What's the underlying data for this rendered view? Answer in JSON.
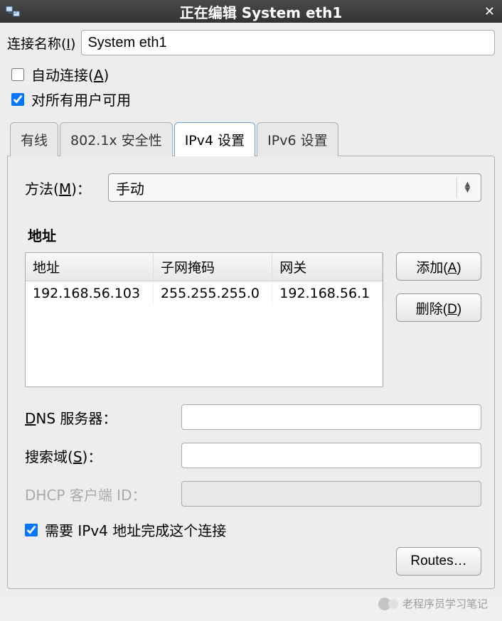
{
  "titlebar": {
    "title": "正在编辑  System eth1"
  },
  "connection": {
    "name_label_prefix": "连接名称(",
    "name_label_key": "I",
    "name_label_suffix": ")",
    "name_value": "System eth1"
  },
  "checkboxes": {
    "autoconnect_prefix": "自动连接(",
    "autoconnect_key": "A",
    "autoconnect_suffix": ")",
    "all_users": "对所有用户可用"
  },
  "tabs": {
    "wired": "有线",
    "security": "802.1x 安全性",
    "ipv4": "IPv4 设置",
    "ipv6": "IPv6 设置"
  },
  "ipv4": {
    "method_label_prefix": "方法(",
    "method_label_key": "M",
    "method_label_suffix": ")：",
    "method_value": "手动",
    "addresses_title": "地址",
    "headers": {
      "address": "地址",
      "netmask": "子网掩码",
      "gateway": "网关"
    },
    "rows": [
      {
        "address": "192.168.56.103",
        "netmask": "255.255.255.0",
        "gateway": "192.168.56.1"
      }
    ],
    "add_btn_prefix": "添加(",
    "add_btn_key": "A",
    "add_btn_suffix": ")",
    "del_btn_prefix": "删除(",
    "del_btn_key": "D",
    "del_btn_suffix": ")",
    "dns_label_prefix": "",
    "dns_label_key": "D",
    "dns_label_rest": "NS 服务器：",
    "search_label_prefix": "搜索域(",
    "search_label_key": "S",
    "search_label_suffix": ")：",
    "dhcp_label": "DHCP 客户端 ID：",
    "require_ipv4": "需要 IPv4 地址完成这个连接",
    "routes_btn": "Routes…",
    "dns_value": "",
    "search_value": "",
    "dhcp_value": ""
  },
  "watermark": "老程序员学习笔记"
}
